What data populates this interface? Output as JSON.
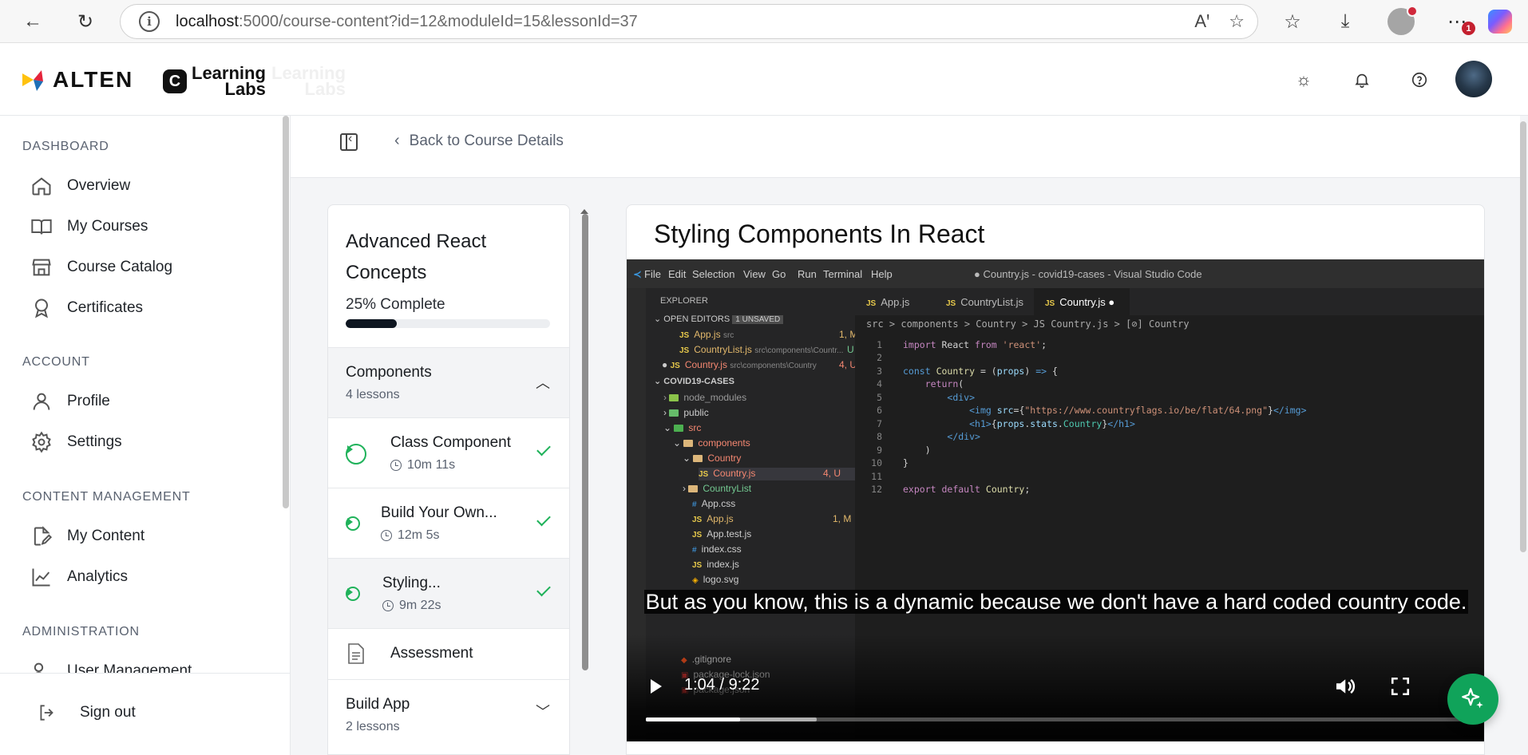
{
  "browser": {
    "url_host": "localhost",
    "url_path": ":5000/course-content?id=12&moduleId=15&lessonId=37",
    "download_badge": "1"
  },
  "header": {
    "brand": "ALTEN",
    "product_line1": "Learning",
    "product_line2": "Labs"
  },
  "sidebar": {
    "sections": [
      {
        "title": "DASHBOARD",
        "items": [
          {
            "label": "Overview",
            "icon": "home-icon"
          },
          {
            "label": "My Courses",
            "icon": "book-icon"
          },
          {
            "label": "Course Catalog",
            "icon": "store-icon"
          },
          {
            "label": "Certificates",
            "icon": "award-icon"
          }
        ]
      },
      {
        "title": "ACCOUNT",
        "items": [
          {
            "label": "Profile",
            "icon": "user-icon"
          },
          {
            "label": "Settings",
            "icon": "gear-icon"
          }
        ]
      },
      {
        "title": "CONTENT MANAGEMENT",
        "items": [
          {
            "label": "My Content",
            "icon": "file-edit-icon"
          },
          {
            "label": "Analytics",
            "icon": "chart-line-icon"
          }
        ]
      },
      {
        "title": "ADMINISTRATION",
        "items": [
          {
            "label": "User Management",
            "icon": "users-cog-icon"
          }
        ]
      }
    ],
    "signout_label": "Sign out"
  },
  "content": {
    "back_label": "Back to Course Details"
  },
  "course": {
    "title": "Advanced React Concepts",
    "progress_label": "25% Complete",
    "progress_value": 0.25,
    "modules": [
      {
        "title": "Components",
        "lesson_count": "4 lessons",
        "expanded": true,
        "lessons": [
          {
            "title": "Class Component",
            "duration": "10m 11s",
            "completed": true
          },
          {
            "title": "Build Your Own...",
            "duration": "12m 5s",
            "completed": true
          },
          {
            "title": "Styling...",
            "duration": "9m 22s",
            "completed": true,
            "active": true
          },
          {
            "title": "Assessment",
            "type": "assessment"
          }
        ]
      },
      {
        "title": "Build App",
        "lesson_count": "2 lessons",
        "expanded": false
      }
    ]
  },
  "video": {
    "title": "Styling Components In React",
    "subtitle": "But as you know, this is a dynamic because we don't have a hard coded country code.",
    "time_label": "1:04 / 9:22",
    "progress_fraction": 0.114,
    "buffered_fraction": 0.207,
    "vscode": {
      "window_title": "● Country.js - covid19-cases - Visual Studio Code",
      "menu": [
        "File",
        "Edit",
        "Selection",
        "View",
        "Go",
        "Run",
        "Terminal",
        "Help"
      ],
      "tabs": [
        "App.js",
        "CountryList.js",
        "Country.js"
      ],
      "breadcrumb": "src > components > Country > JS Country.js > [⊘] Country",
      "explorer_title": "EXPLORER",
      "open_editors_label": "OPEN EDITORS",
      "unsaved_badge": "1 UNSAVED",
      "project": "COVID19-CASES",
      "code_lines": [
        "import React from 'react';",
        "",
        "const Country = (props) => {",
        "    return(",
        "        <div>",
        "            <img src={\"https://www.countryflags.io/be/flat/64.png\"}</img>",
        "            <h1>{props.stats.Country}</h1>",
        "        </div>",
        "    )",
        "}",
        "",
        "export default Country;"
      ]
    }
  }
}
